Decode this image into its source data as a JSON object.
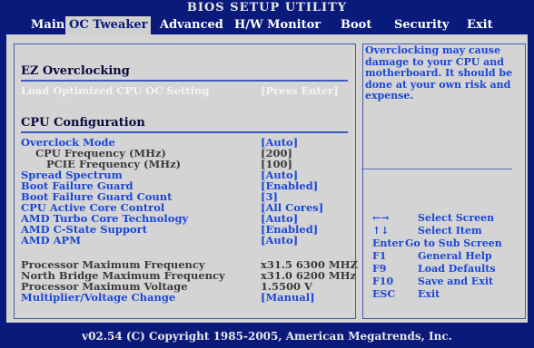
{
  "title": "BIOS SETUP UTILITY",
  "menu": [
    "Main",
    "OC Tweaker",
    "Advanced",
    "H/W Monitor",
    "Boot",
    "Security",
    "Exit"
  ],
  "sections": {
    "ez_title": "EZ Overclocking",
    "cpu_title": "CPU Configuration"
  },
  "load_optimized": {
    "label": "Load Optimized CPU OC Setting",
    "value": "[Press Enter]"
  },
  "items": [
    {
      "label": "Overclock Mode",
      "value": "[Auto]"
    },
    {
      "label": "CPU Frequency (MHz)",
      "value": "[200]"
    },
    {
      "label": "PCIE Frequency (MHz)",
      "value": "[100]"
    },
    {
      "label": "Spread Spectrum",
      "value": "[Auto]"
    },
    {
      "label": "Boot Failure Guard",
      "value": "[Enabled]"
    },
    {
      "label": "Boot Failure Guard Count",
      "value": "[3]"
    },
    {
      "label": "CPU Active Core Control",
      "value": "[All Cores]"
    },
    {
      "label": "AMD Turbo Core Technology",
      "value": "[Auto]"
    },
    {
      "label": "AMD C-State Support",
      "value": "[Enabled]"
    },
    {
      "label": "AMD APM",
      "value": "[Auto]"
    }
  ],
  "info": [
    {
      "label": "Processor Maximum Frequency",
      "value": "x31.5 6300 MHZ"
    },
    {
      "label": "North Bridge Maximum Frequency",
      "value": "x31.0 6200 MHz"
    },
    {
      "label": "Processor Maximum Voltage",
      "value": "1.5500 V"
    }
  ],
  "multiplier": {
    "label": "Multiplier/Voltage Change",
    "value": "[Manual]"
  },
  "help_text": "Overclocking may cause damage to your CPU and motherboard. It should be done at your own risk and expense.",
  "keys": [
    {
      "key": "←→",
      "desc": "Select Screen"
    },
    {
      "key": "↑↓",
      "desc": "Select Item"
    },
    {
      "key": "Enter",
      "desc": "Go to Sub Screen"
    },
    {
      "key": "F1",
      "desc": "General Help"
    },
    {
      "key": "F9",
      "desc": "Load Defaults"
    },
    {
      "key": "F10",
      "desc": "Save and Exit"
    },
    {
      "key": "ESC",
      "desc": "Exit"
    }
  ],
  "footer": "v02.54 (C) Copyright 1985-2005, American Megatrends, Inc."
}
